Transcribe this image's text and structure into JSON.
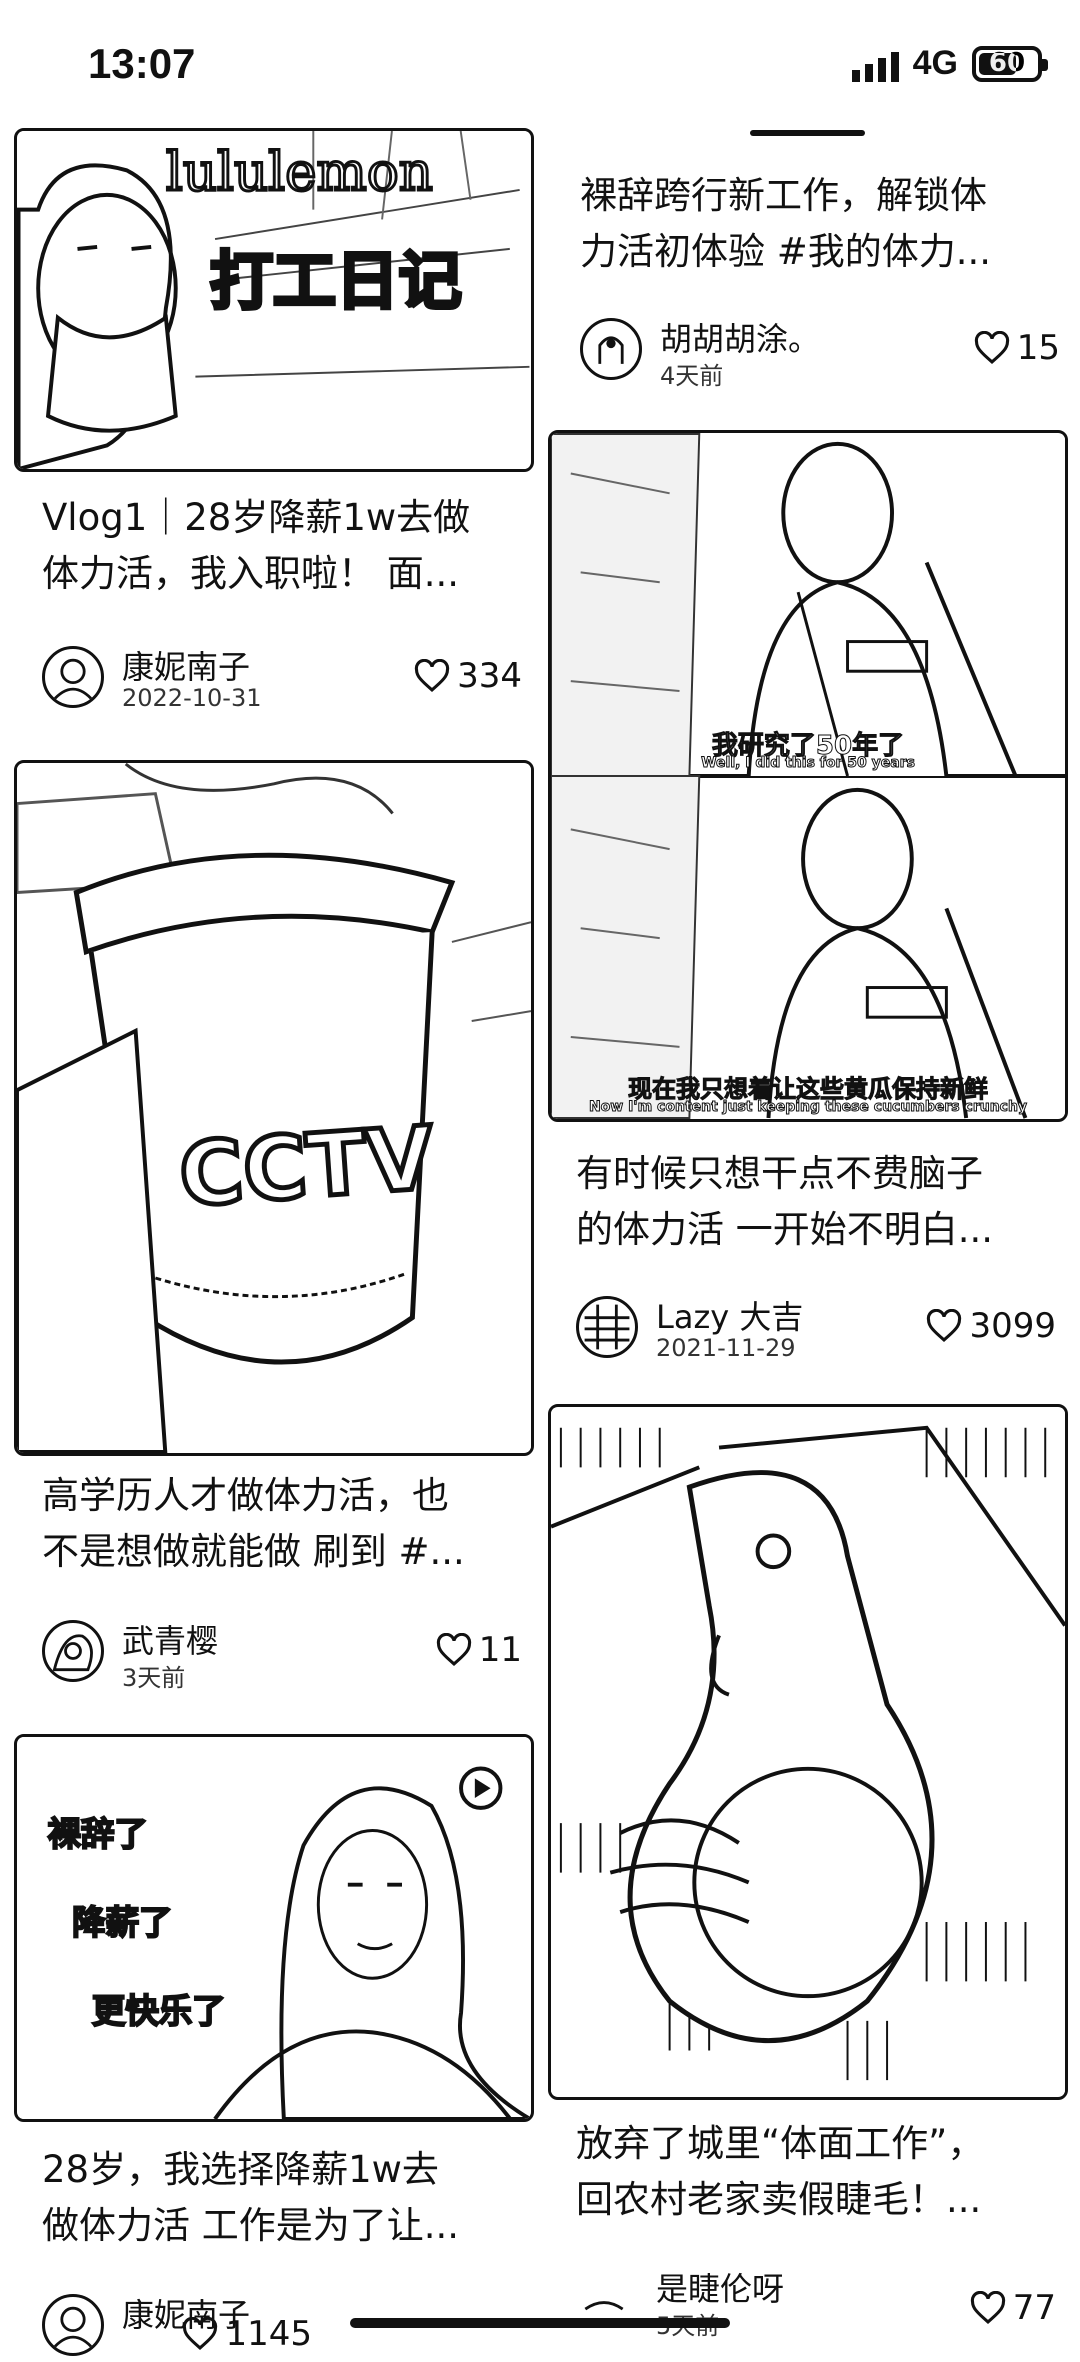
{
  "status": {
    "time": "13:07",
    "network": "4G",
    "battery": "60"
  },
  "feed": {
    "left": [
      {
        "thumb_text_a": "lululemon",
        "thumb_text_b": "打工日记",
        "title_l1": "Vlog1｜28岁降薪1w去做",
        "title_l2": "体力活，我入职啦！ 面...",
        "author": "康妮南子",
        "date": "2022-10-31",
        "likes": "334"
      },
      {
        "thumb_text": "CCTV",
        "title_l1": "高学历人才做体力活，也",
        "title_l2": "不是想做就能做 刷到 #...",
        "author": "武青樱",
        "date": "3天前",
        "likes": "11"
      },
      {
        "thumb_lines": [
          "裸辞了",
          "降薪了",
          "更快乐了"
        ],
        "title_l1": "28岁，我选择降薪1w去",
        "title_l2": "做体力活 工作是为了让...",
        "author": "康妮南子",
        "likes": "1145"
      }
    ],
    "right": [
      {
        "title_l1": "裸辞跨行新工作，解锁体",
        "title_l2": "力活初体验 #我的体力...",
        "author": "胡胡胡涂。",
        "date": "4天前",
        "likes": "15"
      },
      {
        "subtitle_a": "我研究了50年了",
        "subtitle_a_en": "Well, I did this for 50 years",
        "subtitle_b": "现在我只想着让这些黄瓜保持新鲜",
        "subtitle_b_en": "Now I'm content just keeping these cucumbers crunchy",
        "title_l1": "有时候只想干点不费脑子",
        "title_l2": "的体力活 一开始不明白...",
        "author": "Lazy 大吉",
        "date": "2021-11-29",
        "likes": "3099"
      },
      {
        "title_l1": "放弃了城里“体面工作”，",
        "title_l2": "回农村老家卖假睫毛！...",
        "author": "是睫伦呀",
        "date": "5天前",
        "likes": "77"
      }
    ]
  },
  "icons": {
    "heart": "heart-outline-icon",
    "play": "play-icon"
  }
}
